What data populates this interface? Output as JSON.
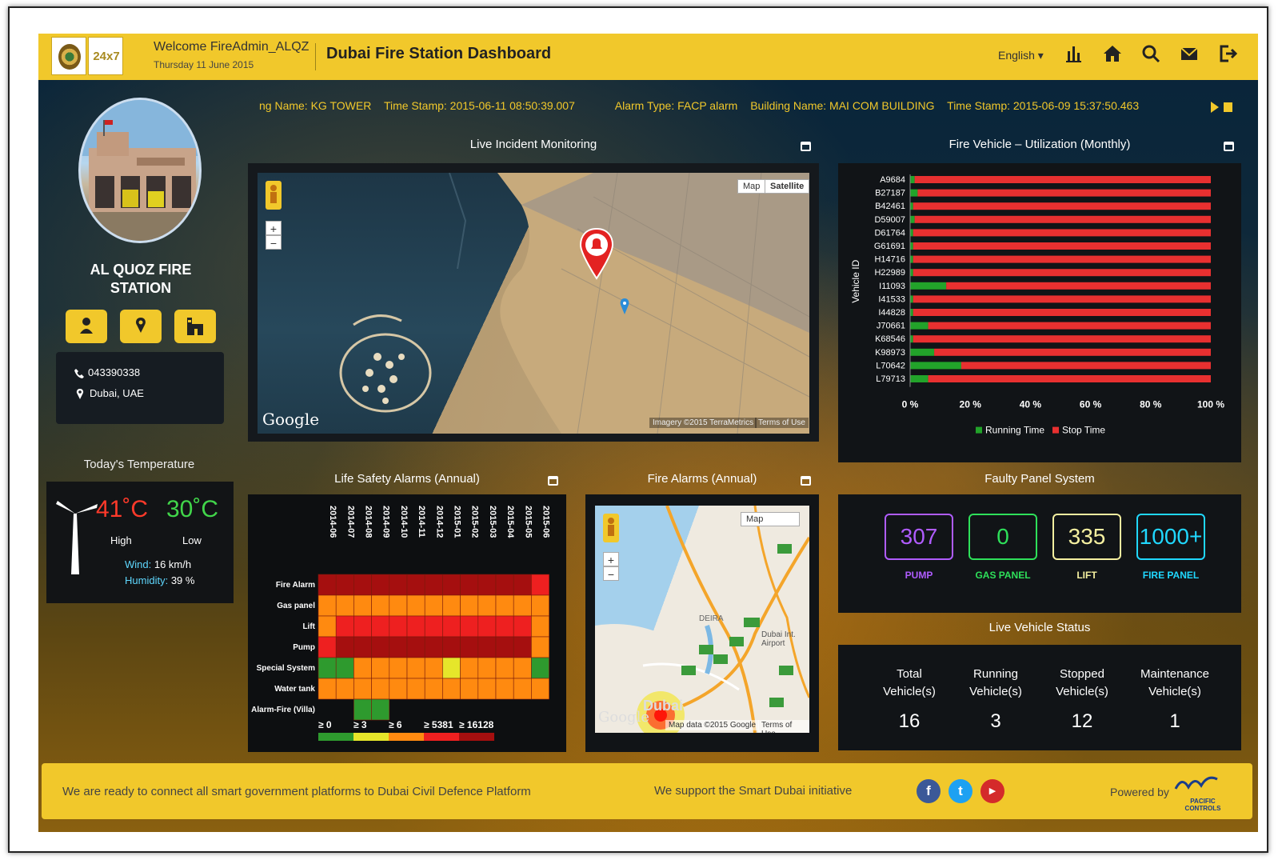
{
  "header": {
    "welcome": "Welcome FireAdmin_ALQZ",
    "date": "Thursday 11 June 2015",
    "title": "Dubai Fire Station Dashboard",
    "language": "English ▾",
    "logo2_text": "24x7"
  },
  "ticker": {
    "item1": "ng Name: KG TOWER",
    "item2": "Time Stamp: 2015-06-11 08:50:39.007",
    "item3": "Alarm Type: FACP alarm",
    "item4": "Building Name: MAI COM BUILDING",
    "item5": "Time Stamp: 2015-06-09 15:37:50.463"
  },
  "station": {
    "name_line1": "AL QUOZ FIRE",
    "name_line2": "STATION",
    "phone": "043390338",
    "location": "Dubai, UAE"
  },
  "temperature": {
    "title": "Today's Temperature",
    "high": "41˚C",
    "low": "30˚C",
    "high_label": "High",
    "low_label": "Low",
    "wind_label": "Wind:",
    "wind_value": "16 km/h",
    "humidity_label": "Humidity:",
    "humidity_value": "39 %"
  },
  "panels": {
    "live_incident": "Live Incident Monitoring",
    "vehicle_util": "Fire Vehicle – Utilization (Monthly)",
    "life_safety": "Life Safety Alarms (Annual)",
    "fire_alarms": "Fire Alarms (Annual)",
    "faulty_panel": "Faulty Panel System",
    "live_vehicle": "Live Vehicle Status"
  },
  "map1": {
    "map_btn": "Map",
    "satellite_btn": "Satellite",
    "google": "Google",
    "credit": "Imagery ©2015 TerraMetrics",
    "terms": "Terms of Use"
  },
  "map2": {
    "map_btn": "Map",
    "google": "Google",
    "credit": "Map data ©2015 Google",
    "terms": "Terms of Use",
    "label_deira": "DEIRA",
    "label_airport": "Dubai Int. Airport",
    "label_city": "Dubai"
  },
  "chart_data": [
    {
      "type": "bar",
      "orientation": "horizontal-stacked",
      "title": "Fire Vehicle – Utilization (Monthly)",
      "ylabel": "Vehicle ID",
      "categories": [
        "A9684",
        "B27187",
        "B42461",
        "D59007",
        "D61764",
        "G61691",
        "H14716",
        "H22989",
        "I11093",
        "I41533",
        "I44828",
        "J70661",
        "K68546",
        "K98973",
        "L70642",
        "L79713"
      ],
      "series": [
        {
          "name": "Running Time",
          "color": "#22a32a",
          "values": [
            1.5,
            2.5,
            1,
            1.5,
            1,
            1,
            1,
            1,
            12,
            1,
            1,
            6,
            1,
            8,
            17,
            6
          ]
        },
        {
          "name": "Stop Time",
          "color": "#e83030",
          "values": [
            98.5,
            97.5,
            99,
            98.5,
            99,
            99,
            99,
            99,
            88,
            99,
            99,
            94,
            99,
            92,
            83,
            94
          ]
        }
      ],
      "xticks": [
        "0 %",
        "20 %",
        "40 %",
        "60 %",
        "80 %",
        "100 %"
      ],
      "xlim": [
        0,
        100
      ]
    },
    {
      "type": "heatmap",
      "title": "Life Safety Alarms (Annual)",
      "columns": [
        "2014-06",
        "2014-07",
        "2014-08",
        "2014-09",
        "2014-10",
        "2014-11",
        "2014-12",
        "2015-01",
        "2015-02",
        "2015-03",
        "2015-04",
        "2015-05",
        "2015-06"
      ],
      "rows": [
        "Fire Alarm",
        "Gas panel",
        "Lift",
        "Pump",
        "Special System",
        "Water tank",
        "Alarm-Fire (Villa)"
      ],
      "cells": [
        [
          4,
          4,
          4,
          4,
          4,
          4,
          4,
          4,
          4,
          4,
          4,
          4,
          3
        ],
        [
          2,
          2,
          2,
          2,
          2,
          2,
          2,
          2,
          2,
          2,
          2,
          2,
          2
        ],
        [
          2,
          3,
          3,
          3,
          3,
          3,
          3,
          3,
          3,
          3,
          3,
          3,
          2
        ],
        [
          3,
          4,
          4,
          4,
          4,
          4,
          4,
          4,
          4,
          4,
          4,
          4,
          2
        ],
        [
          0,
          0,
          2,
          2,
          2,
          2,
          2,
          1,
          2,
          2,
          2,
          2,
          0
        ],
        [
          2,
          2,
          2,
          2,
          2,
          2,
          2,
          2,
          2,
          2,
          2,
          2,
          2
        ],
        [
          -1,
          -1,
          0,
          0,
          -1,
          -1,
          -1,
          -1,
          -1,
          -1,
          -1,
          -1,
          -1
        ]
      ],
      "legend": [
        {
          "label": "≥ 0",
          "color": "#2e9a2e"
        },
        {
          "label": "≥ 3",
          "color": "#e6e62a"
        },
        {
          "label": "≥ 6",
          "color": "#ff8a10"
        },
        {
          "label": "≥ 5381",
          "color": "#ee2020"
        },
        {
          "label": "≥ 16128",
          "color": "#a50f0f"
        }
      ]
    }
  ],
  "faulty": [
    {
      "value": "307",
      "label": "PUMP",
      "color": "#b05cff"
    },
    {
      "value": "0",
      "label": "GAS PANEL",
      "color": "#2ee05a"
    },
    {
      "value": "335",
      "label": "LIFT",
      "color": "#f5f0a0"
    },
    {
      "value": "1000+",
      "label": "FIRE PANEL",
      "color": "#20d8ff"
    }
  ],
  "live_vehicle": [
    {
      "l1": "Total",
      "l2": "Vehicle(s)",
      "value": "16"
    },
    {
      "l1": "Running",
      "l2": "Vehicle(s)",
      "value": "3"
    },
    {
      "l1": "Stopped",
      "l2": "Vehicle(s)",
      "value": "12"
    },
    {
      "l1": "Maintenance",
      "l2": "Vehicle(s)",
      "value": "1"
    }
  ],
  "footer": {
    "left": "We are ready to connect all smart government platforms to Dubai Civil Defence Platform",
    "mid": "We support the Smart Dubai initiative",
    "powered": "Powered by",
    "pcl": "PACIFIC CONTROLS"
  },
  "colors": {
    "accent": "#f1c82b",
    "running": "#22a32a",
    "stop": "#e83030"
  }
}
